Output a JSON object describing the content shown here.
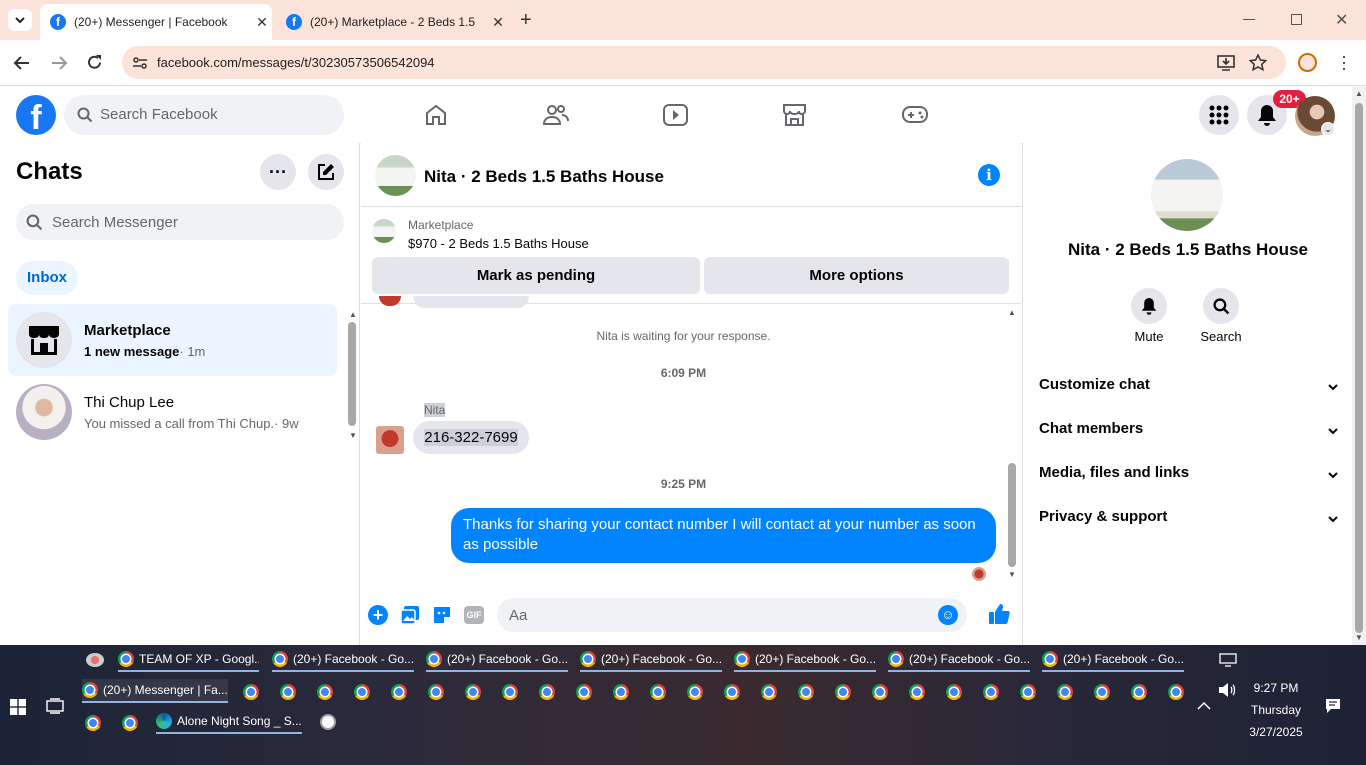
{
  "browser": {
    "tabs": [
      {
        "title": "(20+) Messenger | Facebook",
        "active": true
      },
      {
        "title": "(20+) Marketplace - 2 Beds 1.5",
        "active": false
      }
    ],
    "url": "facebook.com/messages/t/30230573506542094"
  },
  "fb": {
    "search_placeholder": "Search Facebook",
    "notif_badge": "20+"
  },
  "chats": {
    "title": "Chats",
    "search_placeholder": "Search Messenger",
    "filter": "Inbox",
    "items": [
      {
        "name": "Marketplace",
        "preview": "1 new message",
        "time": "· 1m",
        "selected": true
      },
      {
        "name": "Thi Chup Lee",
        "preview": "You missed a call from Thi Chup.",
        "time": "· 9w",
        "selected": false
      }
    ]
  },
  "conversation": {
    "name": "Nita · 2 Beds 1.5 Baths House",
    "marketplace_label": "Marketplace",
    "item": "$970 - 2 Beds 1.5 Baths House",
    "mark_pending": "Mark as pending",
    "more_options": "More options",
    "waiting_text": "Nita is waiting for your response.",
    "time1": "6:09 PM",
    "sender": "Nita",
    "phone": "216-322-7699",
    "time2": "9:25 PM",
    "my_message": "Thanks for sharing your contact number I will contact at your number as soon as possible",
    "composer_placeholder": "Aa",
    "gif_label": "GIF"
  },
  "details": {
    "name": "Nita · 2 Beds 1.5 Baths House",
    "mute": "Mute",
    "search": "Search",
    "sections": [
      "Customize chat",
      "Chat members",
      "Media, files and links",
      "Privacy & support"
    ]
  },
  "taskbar": {
    "row1": [
      "TEAM OF XP - Googl...",
      "(20+) Facebook - Go...",
      "(20+) Facebook - Go...",
      "(20+) Facebook - Go...",
      "(20+) Facebook - Go...",
      "(20+) Facebook - Go...",
      "(20+) Facebook - Go..."
    ],
    "row2_first": "(20+) Messenger | Fa...",
    "row3_edge": "Alone Night Song _ S...",
    "time": "9:27 PM",
    "day": "Thursday",
    "date": "3/27/2025"
  },
  "colors": {
    "fb_blue": "#1877f2",
    "messenger_blue": "#0084ff",
    "chrome_peach": "#fbe3d9",
    "badge_red": "#e41e3f"
  }
}
